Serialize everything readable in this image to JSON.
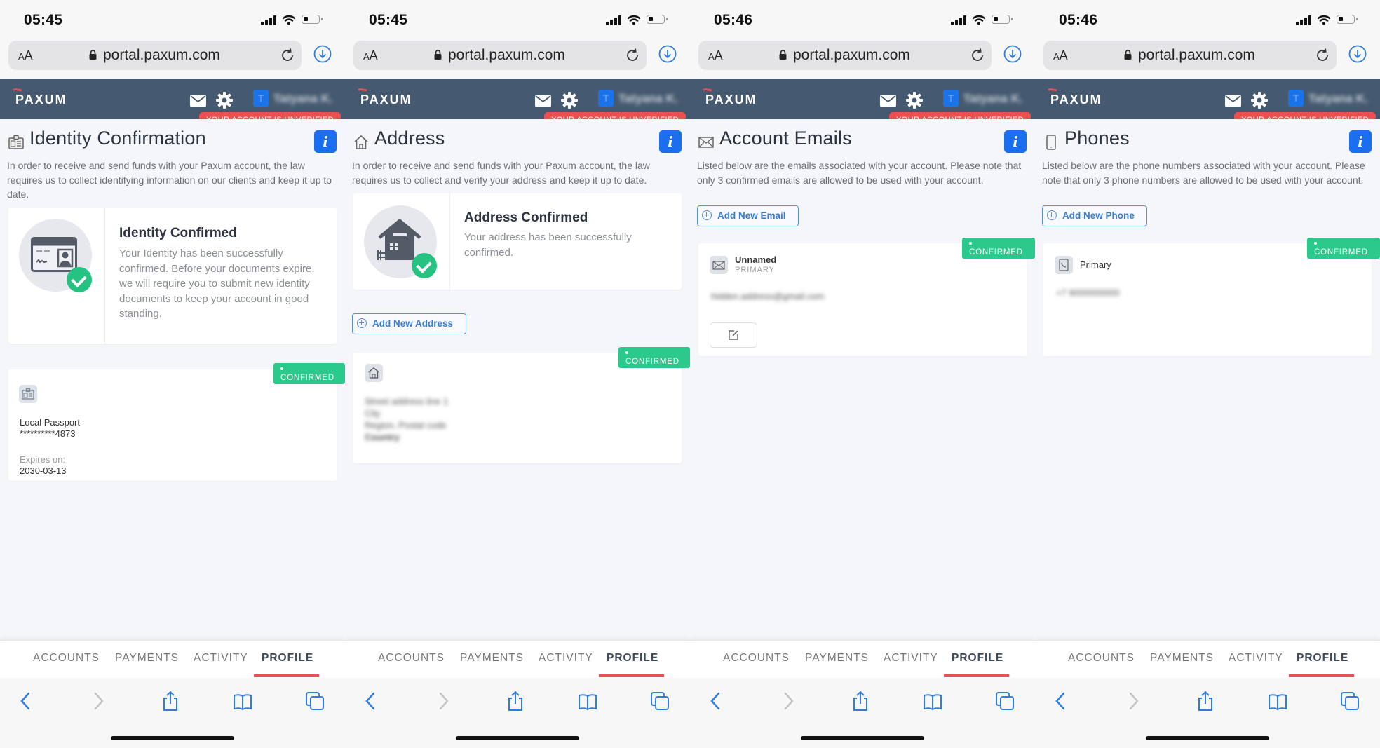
{
  "browser": {
    "url": "portal.paxum.com",
    "text_size_label": "AA"
  },
  "app": {
    "brand": "PAXUM",
    "user_avatar_letter": "T",
    "user_name": "Tatyana K.",
    "unverified_label": "YOUR ACCOUNT IS UNVERIFIED",
    "info_label": "i",
    "badge_confirmed": "CONFIRMED"
  },
  "tabs": [
    {
      "label": "ACCOUNTS",
      "active": false
    },
    {
      "label": "PAYMENTS",
      "active": false
    },
    {
      "label": "ACTIVITY",
      "active": false
    },
    {
      "label": "PROFILE",
      "active": true
    }
  ],
  "screens": [
    {
      "time": "05:45",
      "title": "Identity Confirmation",
      "title_icon": "id-card-icon",
      "description": "In order to receive and send funds with your Paxum account, the law requires us to collect identifying information on our clients and keep it up to date.",
      "hero": {
        "title": "Identity Confirmed",
        "text": "Your Identity has been successfully confirmed. Before your documents expire, we will require you to submit new identity documents to keep your account in good standing."
      },
      "document": {
        "type": "Local Passport",
        "number": "**********4873",
        "expires_label": "Expires on:",
        "expires_value": "2030-03-13",
        "status": "CONFIRMED"
      }
    },
    {
      "time": "05:45",
      "title": "Address",
      "title_icon": "home-icon",
      "description": "In order to receive and send funds with your Paxum account, the law requires us to collect and verify your address and keep it up to date.",
      "hero": {
        "title": "Address Confirmed",
        "text": "Your address has been successfully confirmed."
      },
      "add_button": "Add New Address",
      "address": {
        "lines": [
          "Street address line 1",
          "City",
          "Region, Postal code",
          "Country"
        ],
        "status": "CONFIRMED"
      }
    },
    {
      "time": "05:46",
      "title": "Account Emails",
      "title_icon": "envelope-icon",
      "description": "Listed below are the emails associated with your account. Please note that only 3 confirmed emails are allowed to be used with your account.",
      "add_button": "Add New Email",
      "email": {
        "name": "Unnamed",
        "tag": "PRIMARY",
        "address": "hidden.address@gmail.com",
        "status": "CONFIRMED"
      }
    },
    {
      "time": "05:46",
      "title": "Phones",
      "title_icon": "mobile-phone-icon",
      "description": "Listed below are the phone numbers associated with your account. Please note that only 3 phone numbers are allowed to be used with your account.",
      "add_button": "Add New Phone",
      "phone": {
        "label": "Primary",
        "number": "+7 9000000000",
        "status": "CONFIRMED"
      }
    }
  ],
  "colors": {
    "header_bg": "#455a70",
    "unverified_red": "#ec4e52",
    "confirmed_green": "#2cc98c",
    "info_blue": "#1a6ff0",
    "tab_underline": "#e65157",
    "link_blue": "#3b7cd0"
  }
}
